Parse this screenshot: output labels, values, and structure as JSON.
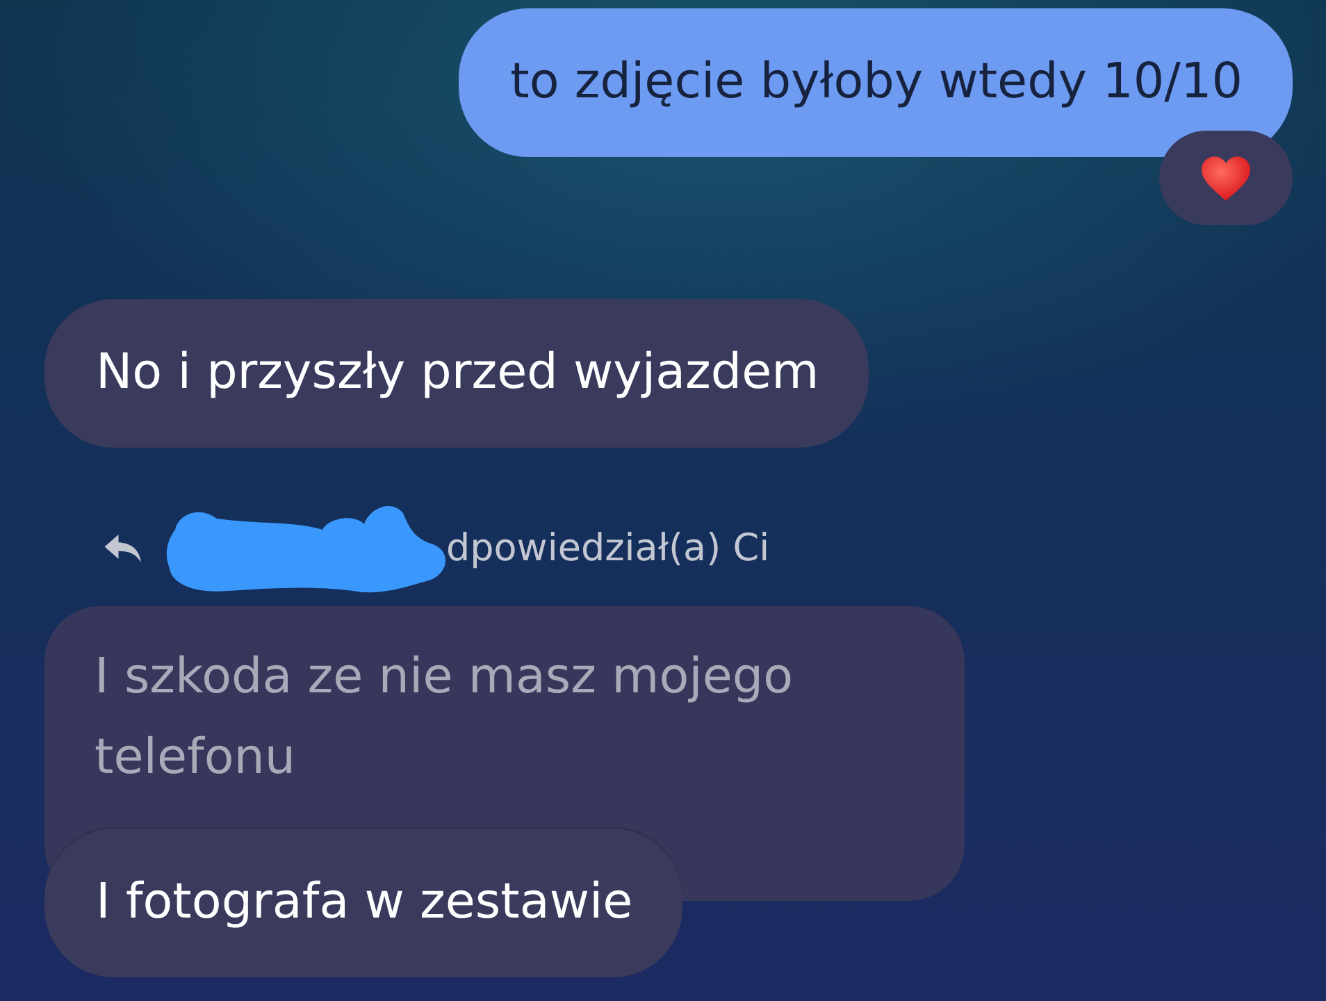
{
  "messages": [
    {
      "kind": "outgoing",
      "text": "to zdjęcie byłoby wtedy 10/10",
      "reacted": true
    },
    {
      "kind": "incoming",
      "text": "No i przyszły przed wyjazdem",
      "reacted": false
    },
    {
      "kind": "reply-note",
      "text": "dpowiedział(a) Ci",
      "redacted": true
    },
    {
      "kind": "quoted",
      "text": "I szkoda ze nie masz mojego telefonu"
    },
    {
      "kind": "incoming",
      "text": "I fotografa w zestawie",
      "reacted": false
    }
  ]
}
